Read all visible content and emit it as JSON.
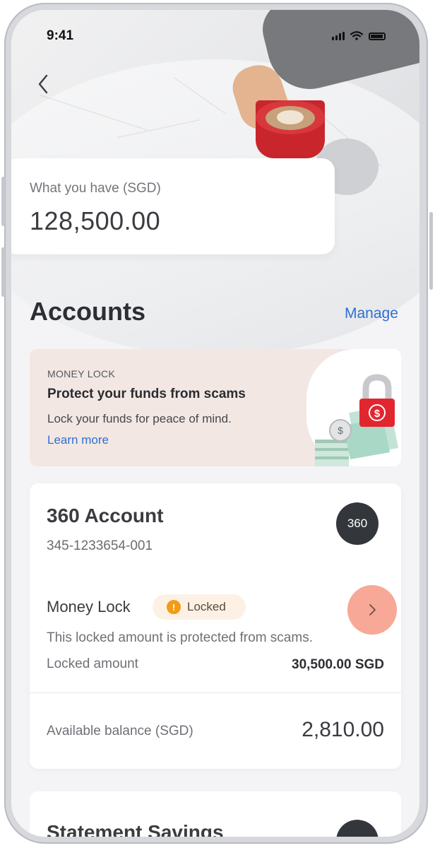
{
  "status_bar": {
    "time": "9:41"
  },
  "summary": {
    "label": "What you have (SGD)",
    "amount": "128,500.00"
  },
  "accounts_section": {
    "title": "Accounts",
    "manage_label": "Manage"
  },
  "promo": {
    "eyebrow": "MONEY LOCK",
    "title": "Protect your funds from scams",
    "subtitle": "Lock your funds for peace of mind.",
    "link": "Learn more"
  },
  "account": {
    "name": "360 Account",
    "number": "345-1233654-001",
    "badge": "360",
    "money_lock_title": "Money Lock",
    "status": "Locked",
    "description": "This locked amount is protected from scams.",
    "locked_label": "Locked amount",
    "locked_amount": "30,500.00 SGD",
    "available_label": "Available balance (SGD)",
    "available_amount": "2,810.00"
  },
  "next_account": {
    "name": "Statement Savings"
  },
  "colors": {
    "link": "#2f6fd3",
    "promo_bg": "#f2e7e3",
    "lock_red": "#e2262f",
    "status_orange": "#f29b15",
    "chevron_highlight": "#f7a896",
    "badge_dark": "#33363b"
  },
  "icons": {
    "back": "chevron-left-icon",
    "chevron": "chevron-right-icon",
    "warning": "exclamation-icon",
    "promo_art": "padlock-dollar-icon"
  }
}
